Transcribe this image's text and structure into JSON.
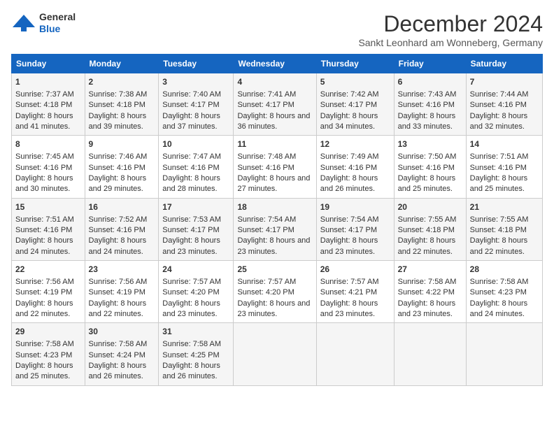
{
  "header": {
    "logo_line1": "General",
    "logo_line2": "Blue",
    "month_title": "December 2024",
    "subtitle": "Sankt Leonhard am Wonneberg, Germany"
  },
  "days_of_week": [
    "Sunday",
    "Monday",
    "Tuesday",
    "Wednesday",
    "Thursday",
    "Friday",
    "Saturday"
  ],
  "weeks": [
    [
      {
        "day": 1,
        "sunrise": "7:37 AM",
        "sunset": "4:18 PM",
        "daylight": "8 hours and 41 minutes."
      },
      {
        "day": 2,
        "sunrise": "7:38 AM",
        "sunset": "4:18 PM",
        "daylight": "8 hours and 39 minutes."
      },
      {
        "day": 3,
        "sunrise": "7:40 AM",
        "sunset": "4:17 PM",
        "daylight": "8 hours and 37 minutes."
      },
      {
        "day": 4,
        "sunrise": "7:41 AM",
        "sunset": "4:17 PM",
        "daylight": "8 hours and 36 minutes."
      },
      {
        "day": 5,
        "sunrise": "7:42 AM",
        "sunset": "4:17 PM",
        "daylight": "8 hours and 34 minutes."
      },
      {
        "day": 6,
        "sunrise": "7:43 AM",
        "sunset": "4:16 PM",
        "daylight": "8 hours and 33 minutes."
      },
      {
        "day": 7,
        "sunrise": "7:44 AM",
        "sunset": "4:16 PM",
        "daylight": "8 hours and 32 minutes."
      }
    ],
    [
      {
        "day": 8,
        "sunrise": "7:45 AM",
        "sunset": "4:16 PM",
        "daylight": "8 hours and 30 minutes."
      },
      {
        "day": 9,
        "sunrise": "7:46 AM",
        "sunset": "4:16 PM",
        "daylight": "8 hours and 29 minutes."
      },
      {
        "day": 10,
        "sunrise": "7:47 AM",
        "sunset": "4:16 PM",
        "daylight": "8 hours and 28 minutes."
      },
      {
        "day": 11,
        "sunrise": "7:48 AM",
        "sunset": "4:16 PM",
        "daylight": "8 hours and 27 minutes."
      },
      {
        "day": 12,
        "sunrise": "7:49 AM",
        "sunset": "4:16 PM",
        "daylight": "8 hours and 26 minutes."
      },
      {
        "day": 13,
        "sunrise": "7:50 AM",
        "sunset": "4:16 PM",
        "daylight": "8 hours and 25 minutes."
      },
      {
        "day": 14,
        "sunrise": "7:51 AM",
        "sunset": "4:16 PM",
        "daylight": "8 hours and 25 minutes."
      }
    ],
    [
      {
        "day": 15,
        "sunrise": "7:51 AM",
        "sunset": "4:16 PM",
        "daylight": "8 hours and 24 minutes."
      },
      {
        "day": 16,
        "sunrise": "7:52 AM",
        "sunset": "4:16 PM",
        "daylight": "8 hours and 24 minutes."
      },
      {
        "day": 17,
        "sunrise": "7:53 AM",
        "sunset": "4:17 PM",
        "daylight": "8 hours and 23 minutes."
      },
      {
        "day": 18,
        "sunrise": "7:54 AM",
        "sunset": "4:17 PM",
        "daylight": "8 hours and 23 minutes."
      },
      {
        "day": 19,
        "sunrise": "7:54 AM",
        "sunset": "4:17 PM",
        "daylight": "8 hours and 23 minutes."
      },
      {
        "day": 20,
        "sunrise": "7:55 AM",
        "sunset": "4:18 PM",
        "daylight": "8 hours and 22 minutes."
      },
      {
        "day": 21,
        "sunrise": "7:55 AM",
        "sunset": "4:18 PM",
        "daylight": "8 hours and 22 minutes."
      }
    ],
    [
      {
        "day": 22,
        "sunrise": "7:56 AM",
        "sunset": "4:19 PM",
        "daylight": "8 hours and 22 minutes."
      },
      {
        "day": 23,
        "sunrise": "7:56 AM",
        "sunset": "4:19 PM",
        "daylight": "8 hours and 22 minutes."
      },
      {
        "day": 24,
        "sunrise": "7:57 AM",
        "sunset": "4:20 PM",
        "daylight": "8 hours and 23 minutes."
      },
      {
        "day": 25,
        "sunrise": "7:57 AM",
        "sunset": "4:20 PM",
        "daylight": "8 hours and 23 minutes."
      },
      {
        "day": 26,
        "sunrise": "7:57 AM",
        "sunset": "4:21 PM",
        "daylight": "8 hours and 23 minutes."
      },
      {
        "day": 27,
        "sunrise": "7:58 AM",
        "sunset": "4:22 PM",
        "daylight": "8 hours and 23 minutes."
      },
      {
        "day": 28,
        "sunrise": "7:58 AM",
        "sunset": "4:23 PM",
        "daylight": "8 hours and 24 minutes."
      }
    ],
    [
      {
        "day": 29,
        "sunrise": "7:58 AM",
        "sunset": "4:23 PM",
        "daylight": "8 hours and 25 minutes."
      },
      {
        "day": 30,
        "sunrise": "7:58 AM",
        "sunset": "4:24 PM",
        "daylight": "8 hours and 26 minutes."
      },
      {
        "day": 31,
        "sunrise": "7:58 AM",
        "sunset": "4:25 PM",
        "daylight": "8 hours and 26 minutes."
      },
      null,
      null,
      null,
      null
    ]
  ]
}
